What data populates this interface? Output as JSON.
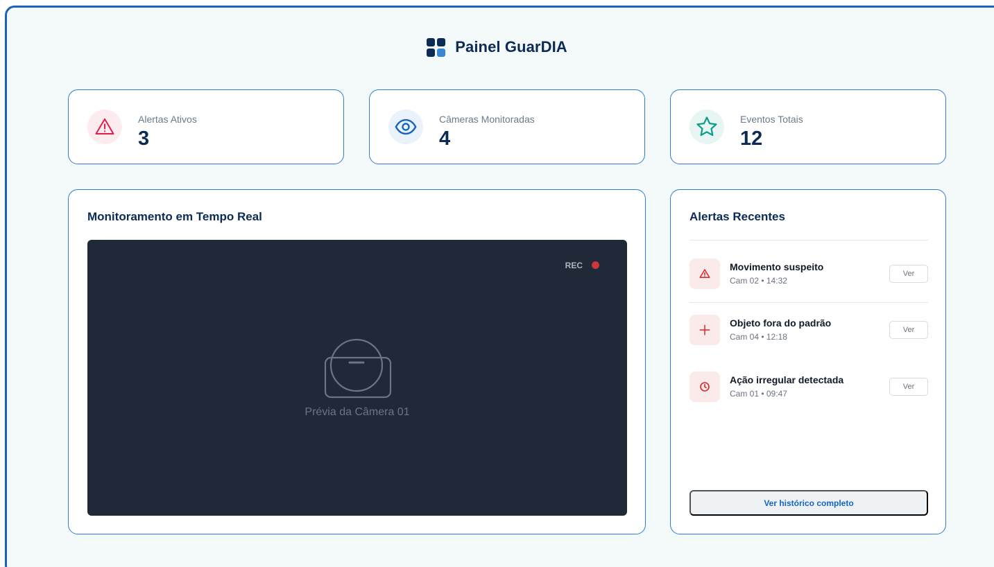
{
  "header": {
    "title": "Painel GuarDIA",
    "icon": "grid-logo-icon"
  },
  "stats": [
    {
      "label": "Alertas Ativos",
      "value": "3",
      "icon": "warning-triangle-icon",
      "color": "#e11d48"
    },
    {
      "label": "Câmeras Monitoradas",
      "value": "4",
      "icon": "eye-icon",
      "color": "#1565c0"
    },
    {
      "label": "Eventos Totais",
      "value": "12",
      "icon": "star-icon",
      "color": "#0f9d8a"
    }
  ],
  "monitor": {
    "title": "Monitoramento em Tempo Real",
    "rec_label": "REC",
    "preview_text": "Prévia da Câmera 01"
  },
  "alerts": {
    "title": "Alertas Recentes",
    "items": [
      {
        "title": "Movimento suspeito",
        "meta": "Cam 02 • 14:32",
        "icon": "warning-triangle-icon",
        "button": "Ver"
      },
      {
        "title": "Objeto fora do padrão",
        "meta": "Cam 04 • 12:18",
        "icon": "plus-icon",
        "button": "Ver"
      },
      {
        "title": "Ação irregular detectada",
        "meta": "Cam 01 • 09:47",
        "icon": "clock-icon",
        "button": "Ver"
      }
    ],
    "history_button": "Ver histórico completo"
  },
  "colors": {
    "accent": "#1565c0",
    "navy": "#0b2a55",
    "alert_red": "#dc2626",
    "video_bg": "#1f2937"
  }
}
